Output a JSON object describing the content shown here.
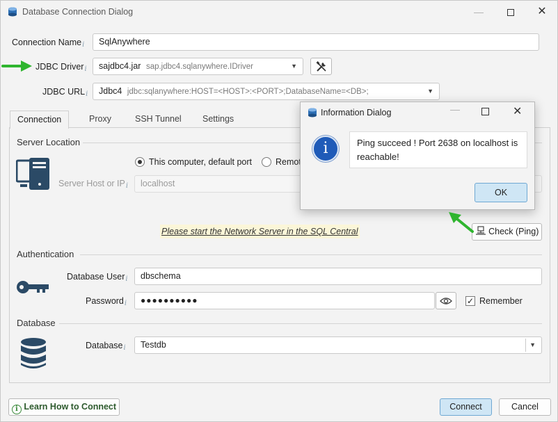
{
  "window": {
    "title": "Database Connection Dialog",
    "minimize_glyph": "—",
    "close_glyph": "✕"
  },
  "form": {
    "connection_name_label": "Connection Name",
    "connection_name_value": "SqlAnywhere",
    "jdbc_driver_label": "JDBC Driver",
    "jdbc_driver_jar": "sajdbc4.jar",
    "jdbc_driver_class": "sap.jdbc4.sqlanywhere.IDriver",
    "jdbc_url_label": "JDBC URL",
    "jdbc_url_name": "Jdbc4",
    "jdbc_url_value": "jdbc:sqlanywhere:HOST=<HOST>:<PORT>;DatabaseName=<DB>;",
    "info_glyph": "i"
  },
  "tabs": [
    {
      "label": "Connection",
      "active": true
    },
    {
      "label": "Proxy",
      "active": false
    },
    {
      "label": "SSH Tunnel",
      "active": false
    },
    {
      "label": "Settings",
      "active": false
    }
  ],
  "server_location": {
    "section_title": "Server Location",
    "radio_this_computer": "This computer, default port",
    "radio_remote": "Remot",
    "host_label": "Server Host or IP",
    "host_value": "localhost",
    "hint_text": "Please start the Network Server in the SQL Central",
    "check_ping_label": "Check (Ping)"
  },
  "authentication": {
    "section_title": "Authentication",
    "user_label": "Database User",
    "user_value": "dbschema",
    "password_label": "Password",
    "password_value": "●●●●●●●●●●",
    "remember_label": "Remember",
    "remember_checked": true
  },
  "database": {
    "section_title": "Database",
    "db_label": "Database",
    "db_value": "Testdb"
  },
  "footer": {
    "learn_label": "Learn How to Connect",
    "connect_label": "Connect",
    "cancel_label": "Cancel"
  },
  "info_dialog": {
    "title": "Information Dialog",
    "message": "Ping succeed ! Port 2638 on localhost is reachable!",
    "ok_label": "OK",
    "info_glyph": "i"
  },
  "colors": {
    "accent": "#1f5bb8",
    "primary_button": "#cfe6f5",
    "annotation_arrow": "#2fb52f",
    "hint_background": "#fbf6d8"
  }
}
